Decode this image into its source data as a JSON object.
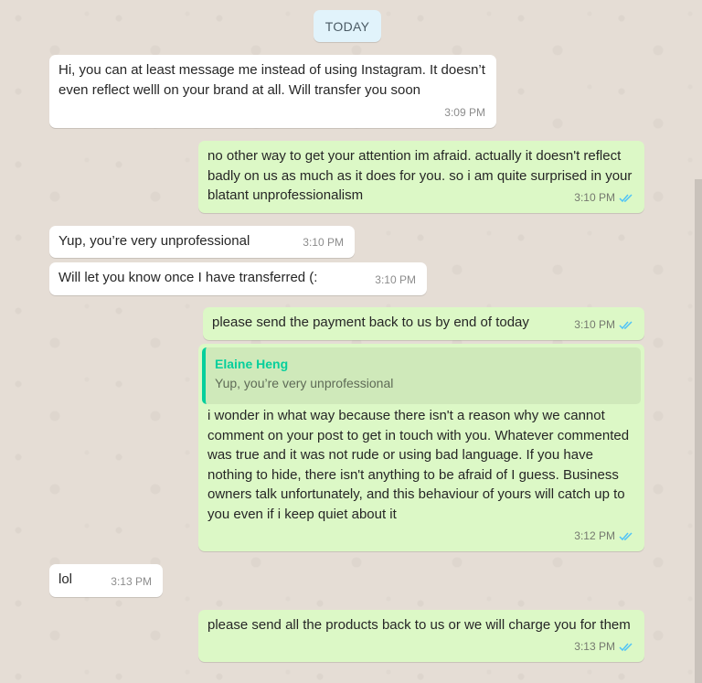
{
  "date_chip": "TODAY",
  "colors": {
    "background": "#e5ddd5",
    "incoming_bubble": "#ffffff",
    "outgoing_bubble": "#dcf8c6",
    "read_ticks": "#4fc3f7",
    "quote_accent": "#06cf9c"
  },
  "messages": [
    {
      "dir": "in",
      "text": "Hi, you can at least message me instead of using Instagram. It doesn’t even reflect welll on your brand at all. Will transfer you soon",
      "time": "3:09 PM"
    },
    {
      "dir": "out",
      "text": "no other way to get your attention im afraid. actually it doesn't reflect badly on us as much as it does for you. so i am quite surprised in your blatant unprofessionalism",
      "time": "3:10 PM",
      "status": "read-double-check-icon"
    },
    {
      "dir": "in",
      "text": "Yup, you’re very unprofessional",
      "time": "3:10 PM"
    },
    {
      "dir": "in",
      "text": "Will let you know once I have transferred (:",
      "time": "3:10 PM"
    },
    {
      "dir": "out",
      "text": "please send the payment back to us by end of today",
      "time": "3:10 PM",
      "status": "read-double-check-icon"
    },
    {
      "dir": "out",
      "quote": {
        "name": "Elaine Heng",
        "text": "Yup, you’re very unprofessional"
      },
      "text": "i wonder in what way because there isn't a reason why we cannot comment on your post to get in touch with you. Whatever commented was true and it was not rude or using bad language. If you have nothing to hide, there isn't anything to be afraid of I guess. Business owners talk unfortunately, and this behaviour of yours will catch up to you even if i keep quiet about it",
      "time": "3:12 PM",
      "status": "read-double-check-icon"
    },
    {
      "dir": "in",
      "text": "lol",
      "time": "3:13 PM"
    },
    {
      "dir": "out",
      "text": "please send all the products back to us or we will charge you for them",
      "time": "3:13 PM",
      "status": "read-double-check-icon"
    }
  ]
}
